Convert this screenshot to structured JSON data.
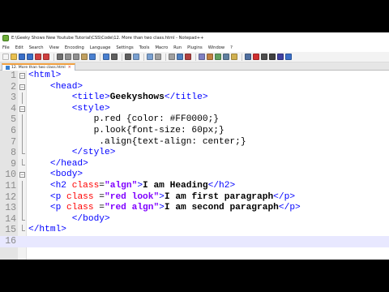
{
  "window": {
    "title": "E:\\Geeky Shows New Youtube Tutorial\\CSS\\Code\\12. More than two class.html - Notepad++"
  },
  "menu": [
    "File",
    "Edit",
    "Search",
    "View",
    "Encoding",
    "Language",
    "Settings",
    "Tools",
    "Macro",
    "Run",
    "Plugins",
    "Window",
    "?"
  ],
  "tab": {
    "label": "12. More than two class.html"
  },
  "editor": {
    "current_line": 16,
    "lines": [
      {
        "n": "1",
        "fold": "box",
        "indent": "",
        "tokens": [
          {
            "c": "t-tag",
            "t": "<html>"
          }
        ]
      },
      {
        "n": "2",
        "fold": "box",
        "indent": "    ",
        "tokens": [
          {
            "c": "t-tag",
            "t": "<head>"
          }
        ]
      },
      {
        "n": "3",
        "fold": "line",
        "indent": "        ",
        "tokens": [
          {
            "c": "t-tag",
            "t": "<title>"
          },
          {
            "c": "t-text",
            "t": "Geekyshows"
          },
          {
            "c": "t-tag",
            "t": "</title>"
          }
        ]
      },
      {
        "n": "4",
        "fold": "box",
        "indent": "        ",
        "tokens": [
          {
            "c": "t-tag",
            "t": "<style>"
          }
        ]
      },
      {
        "n": "5",
        "fold": "line",
        "indent": "            ",
        "tokens": [
          {
            "c": "t-css",
            "t": "p.red {color: #FF0000;}"
          }
        ]
      },
      {
        "n": "6",
        "fold": "line",
        "indent": "            ",
        "tokens": [
          {
            "c": "t-css",
            "t": "p.look{font-size: 60px;}"
          }
        ]
      },
      {
        "n": "7",
        "fold": "line",
        "indent": "             ",
        "tokens": [
          {
            "c": "t-css",
            "t": ".align{text-align: center;}"
          }
        ]
      },
      {
        "n": "8",
        "fold": "end",
        "indent": "        ",
        "tokens": [
          {
            "c": "t-tag",
            "t": "</style>"
          }
        ]
      },
      {
        "n": "9",
        "fold": "end",
        "indent": "    ",
        "tokens": [
          {
            "c": "t-tag",
            "t": "</head>"
          }
        ]
      },
      {
        "n": "10",
        "fold": "box",
        "indent": "    ",
        "tokens": [
          {
            "c": "t-tag",
            "t": "<body>"
          }
        ]
      },
      {
        "n": "11",
        "fold": "line",
        "indent": "    ",
        "tokens": [
          {
            "c": "t-tag",
            "t": "<h2 "
          },
          {
            "c": "t-attr",
            "t": "class"
          },
          {
            "c": "t-eq",
            "t": "="
          },
          {
            "c": "t-val",
            "t": "\"algn\""
          },
          {
            "c": "t-tag",
            "t": ">"
          },
          {
            "c": "t-text",
            "t": "I am Heading"
          },
          {
            "c": "t-tag",
            "t": "</h2>"
          }
        ]
      },
      {
        "n": "12",
        "fold": "line",
        "indent": "    ",
        "tokens": [
          {
            "c": "t-tag",
            "t": "<p "
          },
          {
            "c": "t-attr",
            "t": "class"
          },
          {
            "c": "t-eq",
            "t": " ="
          },
          {
            "c": "t-val",
            "t": "\"red look\""
          },
          {
            "c": "t-tag",
            "t": ">"
          },
          {
            "c": "t-text",
            "t": "I am first paragraph"
          },
          {
            "c": "t-tag",
            "t": "</p>"
          }
        ]
      },
      {
        "n": "13",
        "fold": "line",
        "indent": "    ",
        "tokens": [
          {
            "c": "t-tag",
            "t": "<p "
          },
          {
            "c": "t-attr",
            "t": "class"
          },
          {
            "c": "t-eq",
            "t": " ="
          },
          {
            "c": "t-val",
            "t": "\"red algn\""
          },
          {
            "c": "t-tag",
            "t": ">"
          },
          {
            "c": "t-text",
            "t": "I am second paragraph"
          },
          {
            "c": "t-tag",
            "t": "</p>"
          }
        ]
      },
      {
        "n": "14",
        "fold": "end",
        "indent": "        ",
        "tokens": [
          {
            "c": "t-tag",
            "t": "</body>"
          }
        ]
      },
      {
        "n": "15",
        "fold": "end",
        "indent": "",
        "tokens": [
          {
            "c": "t-tag",
            "t": "</html>"
          }
        ]
      },
      {
        "n": "16",
        "fold": "",
        "indent": "",
        "tokens": []
      }
    ]
  },
  "colors": {
    "tag": "#0000ff",
    "attribute": "#ff0000",
    "attribute_value": "#8000ff",
    "current_line": "#e8e8ff",
    "tab_accent": "#f0a040"
  },
  "icons": {
    "app": "notepadpp-icon",
    "toolbar": [
      "new-file-icon",
      "open-file-icon",
      "save-icon",
      "save-all-icon",
      "close-icon",
      "close-all-icon",
      "print-icon",
      "cut-icon",
      "copy-icon",
      "paste-icon",
      "undo-icon",
      "redo-icon",
      "find-icon",
      "replace-icon",
      "zoom-in-icon",
      "zoom-out-icon",
      "sync-v-icon",
      "sync-h-icon",
      "wrap-icon",
      "all-chars-icon",
      "indent-guide-icon",
      "lang-icon",
      "doc-map-icon",
      "function-list-icon",
      "folder-workspace-icon",
      "monitor-icon",
      "record-macro-icon",
      "stop-record-icon",
      "play-macro-icon",
      "run-macro-multi-icon",
      "save-macro-icon"
    ]
  }
}
